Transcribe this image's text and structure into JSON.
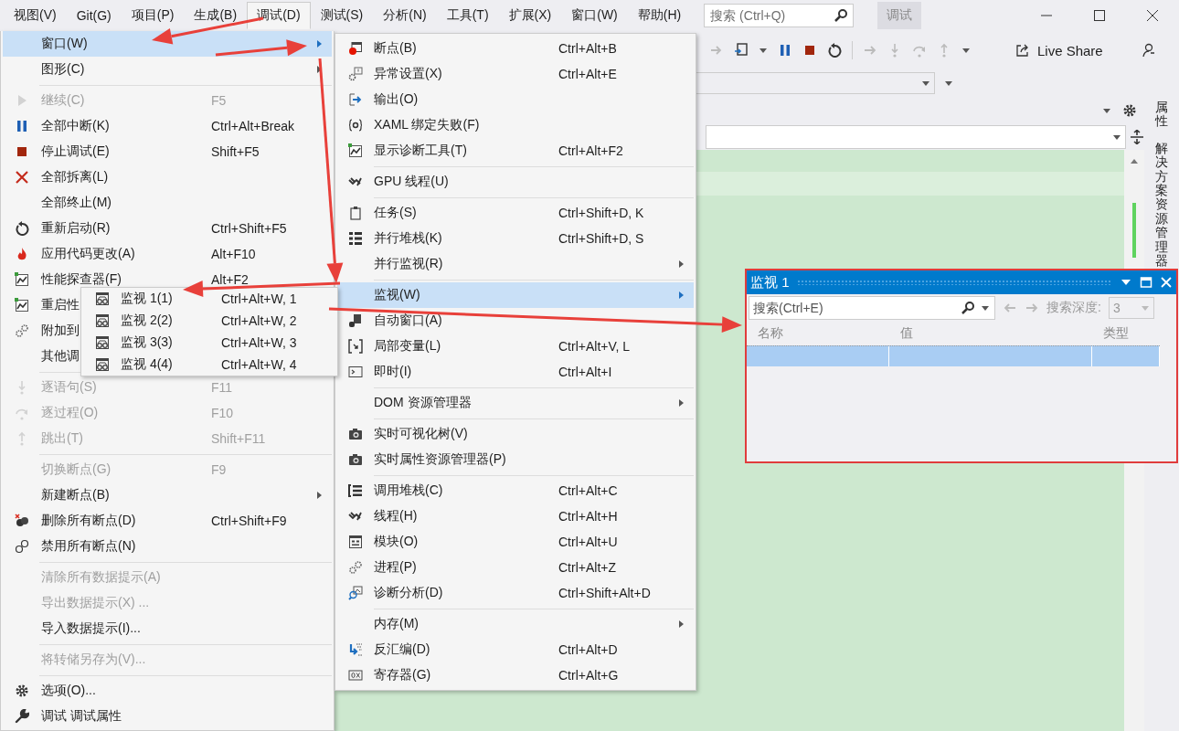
{
  "menubar": {
    "items": [
      {
        "label": "视图(V)",
        "selected": false
      },
      {
        "label": "Git(G)",
        "selected": false
      },
      {
        "label": "项目(P)",
        "selected": false
      },
      {
        "label": "生成(B)",
        "selected": false
      },
      {
        "label": "调试(D)",
        "selected": true
      },
      {
        "label": "测试(S)",
        "selected": false
      },
      {
        "label": "分析(N)",
        "selected": false
      },
      {
        "label": "工具(T)",
        "selected": false
      },
      {
        "label": "扩展(X)",
        "selected": false
      },
      {
        "label": "窗口(W)",
        "selected": false
      },
      {
        "label": "帮助(H)",
        "selected": false
      }
    ],
    "search": {
      "placeholder": "搜索 (Ctrl+Q)"
    },
    "badge": "调试"
  },
  "toolbar": {
    "live_share": "Live Share"
  },
  "side_tabs": [
    "属性",
    "解决方案资源管理器"
  ],
  "debug_menu": {
    "items": [
      {
        "kind": "item",
        "label": "窗口(W)",
        "disabled": false,
        "selected": true,
        "submenu": true
      },
      {
        "kind": "item",
        "label": "图形(C)",
        "disabled": false,
        "selected": false,
        "submenu": true
      },
      {
        "kind": "separator"
      },
      {
        "kind": "item",
        "label": "继续(C)",
        "shortcut": "F5",
        "disabled": true,
        "selected": false,
        "submenu": false
      },
      {
        "kind": "item",
        "label": "全部中断(K)",
        "shortcut": "Ctrl+Alt+Break",
        "disabled": false,
        "selected": false,
        "submenu": false
      },
      {
        "kind": "item",
        "label": "停止调试(E)",
        "shortcut": "Shift+F5",
        "disabled": false,
        "selected": false,
        "submenu": false
      },
      {
        "kind": "item",
        "label": "全部拆离(L)",
        "disabled": false,
        "selected": false,
        "submenu": false
      },
      {
        "kind": "item",
        "label": "全部终止(M)",
        "disabled": false,
        "selected": false,
        "submenu": false
      },
      {
        "kind": "item",
        "label": "重新启动(R)",
        "shortcut": "Ctrl+Shift+F5",
        "disabled": false,
        "selected": false,
        "submenu": false
      },
      {
        "kind": "item",
        "label": "应用代码更改(A)",
        "shortcut": "Alt+F10",
        "disabled": false,
        "selected": false,
        "submenu": false
      },
      {
        "kind": "item",
        "label": "性能探查器(F)",
        "shortcut": "Alt+F2",
        "disabled": false,
        "selected": false,
        "submenu": false
      },
      {
        "kind": "item",
        "label": "重启性",
        "disabled": false,
        "selected": false,
        "submenu": false
      },
      {
        "kind": "item",
        "label": "附加到",
        "disabled": false,
        "selected": false,
        "submenu": false
      },
      {
        "kind": "item",
        "label": "其他调",
        "disabled": false,
        "selected": false,
        "submenu": false
      },
      {
        "kind": "separator"
      },
      {
        "kind": "item",
        "label": "逐语句(S)",
        "shortcut": "F11",
        "disabled": true,
        "selected": false,
        "submenu": false
      },
      {
        "kind": "item",
        "label": "逐过程(O)",
        "shortcut": "F10",
        "disabled": true,
        "selected": false,
        "submenu": false
      },
      {
        "kind": "item",
        "label": "跳出(T)",
        "shortcut": "Shift+F11",
        "disabled": true,
        "selected": false,
        "submenu": false
      },
      {
        "kind": "separator"
      },
      {
        "kind": "item",
        "label": "切换断点(G)",
        "shortcut": "F9",
        "disabled": true,
        "selected": false,
        "submenu": false
      },
      {
        "kind": "item",
        "label": "新建断点(B)",
        "disabled": false,
        "selected": false,
        "submenu": true
      },
      {
        "kind": "item",
        "label": "删除所有断点(D)",
        "shortcut": "Ctrl+Shift+F9",
        "disabled": false,
        "selected": false,
        "submenu": false
      },
      {
        "kind": "item",
        "label": "禁用所有断点(N)",
        "disabled": false,
        "selected": false,
        "submenu": false
      },
      {
        "kind": "separator"
      },
      {
        "kind": "item",
        "label": "清除所有数据提示(A)",
        "disabled": true,
        "selected": false,
        "submenu": false
      },
      {
        "kind": "item",
        "label": "导出数据提示(X) ...",
        "disabled": true,
        "selected": false,
        "submenu": false
      },
      {
        "kind": "item",
        "label": "导入数据提示(I)...",
        "disabled": false,
        "selected": false,
        "submenu": false
      },
      {
        "kind": "separator"
      },
      {
        "kind": "item",
        "label": "将转储另存为(V)...",
        "disabled": true,
        "selected": false,
        "submenu": false
      },
      {
        "kind": "separator"
      },
      {
        "kind": "item",
        "label": "选项(O)...",
        "disabled": false,
        "selected": false,
        "submenu": false
      },
      {
        "kind": "item",
        "label": "调试 调试属性",
        "disabled": false,
        "selected": false,
        "submenu": false
      }
    ]
  },
  "window_submenu": {
    "items": [
      {
        "kind": "item",
        "label": "断点(B)",
        "shortcut": "Ctrl+Alt+B",
        "selected": false,
        "submenu": false
      },
      {
        "kind": "item",
        "label": "异常设置(X)",
        "shortcut": "Ctrl+Alt+E",
        "selected": false,
        "submenu": false
      },
      {
        "kind": "item",
        "label": "输出(O)",
        "selected": false,
        "submenu": false
      },
      {
        "kind": "item",
        "label": "XAML 绑定失败(F)",
        "selected": false,
        "submenu": false
      },
      {
        "kind": "item",
        "label": "显示诊断工具(T)",
        "shortcut": "Ctrl+Alt+F2",
        "selected": false,
        "submenu": false
      },
      {
        "kind": "separator"
      },
      {
        "kind": "item",
        "label": "GPU 线程(U)",
        "selected": false,
        "submenu": false
      },
      {
        "kind": "separator"
      },
      {
        "kind": "item",
        "label": "任务(S)",
        "shortcut": "Ctrl+Shift+D, K",
        "selected": false,
        "submenu": false
      },
      {
        "kind": "item",
        "label": "并行堆栈(K)",
        "shortcut": "Ctrl+Shift+D, S",
        "selected": false,
        "submenu": false
      },
      {
        "kind": "item",
        "label": "并行监视(R)",
        "selected": false,
        "submenu": true
      },
      {
        "kind": "separator"
      },
      {
        "kind": "item",
        "label": "监视(W)",
        "selected": true,
        "submenu": true
      },
      {
        "kind": "item",
        "label": "自动窗口(A)",
        "selected": false,
        "submenu": false
      },
      {
        "kind": "item",
        "label": "局部变量(L)",
        "shortcut": "Ctrl+Alt+V, L",
        "selected": false,
        "submenu": false
      },
      {
        "kind": "item",
        "label": "即时(I)",
        "shortcut": "Ctrl+Alt+I",
        "selected": false,
        "submenu": false
      },
      {
        "kind": "separator"
      },
      {
        "kind": "item",
        "label": "DOM 资源管理器",
        "selected": false,
        "submenu": true
      },
      {
        "kind": "separator"
      },
      {
        "kind": "item",
        "label": "实时可视化树(V)",
        "selected": false,
        "submenu": false
      },
      {
        "kind": "item",
        "label": "实时属性资源管理器(P)",
        "selected": false,
        "submenu": false
      },
      {
        "kind": "separator"
      },
      {
        "kind": "item",
        "label": "调用堆栈(C)",
        "shortcut": "Ctrl+Alt+C",
        "selected": false,
        "submenu": false
      },
      {
        "kind": "item",
        "label": "线程(H)",
        "shortcut": "Ctrl+Alt+H",
        "selected": false,
        "submenu": false
      },
      {
        "kind": "item",
        "label": "模块(O)",
        "shortcut": "Ctrl+Alt+U",
        "selected": false,
        "submenu": false
      },
      {
        "kind": "item",
        "label": "进程(P)",
        "shortcut": "Ctrl+Alt+Z",
        "selected": false,
        "submenu": false
      },
      {
        "kind": "item",
        "label": "诊断分析(D)",
        "shortcut": "Ctrl+Shift+Alt+D",
        "selected": false,
        "submenu": false
      },
      {
        "kind": "separator"
      },
      {
        "kind": "item",
        "label": "内存(M)",
        "selected": false,
        "submenu": true
      },
      {
        "kind": "item",
        "label": "反汇编(D)",
        "shortcut": "Ctrl+Alt+D",
        "selected": false,
        "submenu": false
      },
      {
        "kind": "item",
        "label": "寄存器(G)",
        "shortcut": "Ctrl+Alt+G",
        "selected": false,
        "submenu": false
      }
    ]
  },
  "watch_submenu": {
    "items": [
      {
        "kind": "item",
        "label": "监视 1(1)",
        "shortcut": "Ctrl+Alt+W, 1",
        "selected": false
      },
      {
        "kind": "item",
        "label": "监视 2(2)",
        "shortcut": "Ctrl+Alt+W, 2",
        "selected": false
      },
      {
        "kind": "item",
        "label": "监视 3(3)",
        "shortcut": "Ctrl+Alt+W, 3",
        "selected": false
      },
      {
        "kind": "item",
        "label": "监视 4(4)",
        "shortcut": "Ctrl+Alt+W, 4",
        "selected": false
      }
    ]
  },
  "watch_window": {
    "title": "监视 1",
    "search": {
      "placeholder": "搜索(Ctrl+E)"
    },
    "depth_label": "搜索深度:",
    "depth_value": "3",
    "columns": [
      "名称",
      "值",
      "类型"
    ],
    "rows": [
      {
        "selected": true
      }
    ]
  }
}
